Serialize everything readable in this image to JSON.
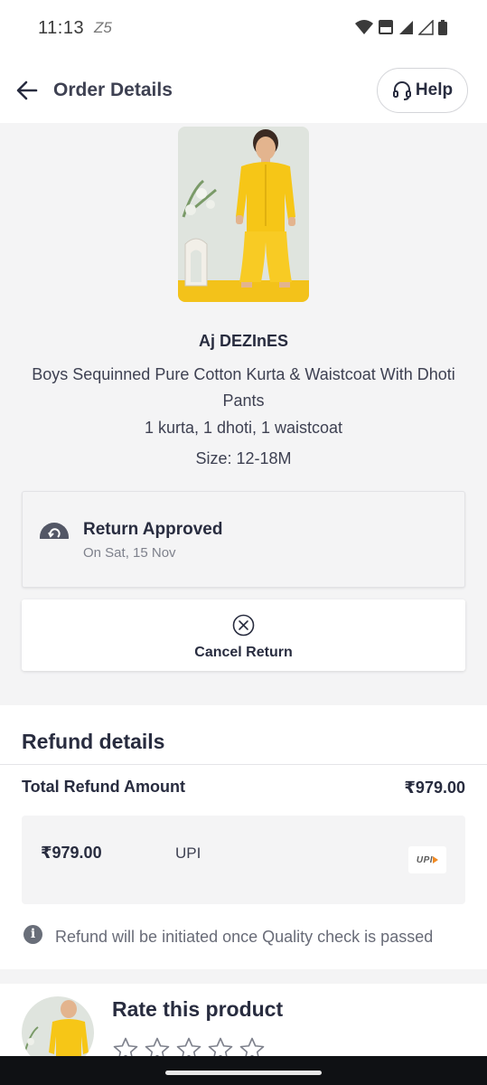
{
  "status_bar": {
    "time": "11:13",
    "indicator": "Z5"
  },
  "header": {
    "title": "Order Details",
    "help_label": "Help"
  },
  "product": {
    "brand": "Aj DEZInES",
    "name": "Boys Sequinned Pure Cotton Kurta & Waistcoat With Dhoti Pants",
    "contents": "1 kurta, 1 dhoti, 1 waistcoat",
    "size": "Size: 12-18M"
  },
  "order_status": {
    "title": "Return Approved",
    "date": "On Sat, 15 Nov"
  },
  "cancel": {
    "label": "Cancel Return"
  },
  "refund": {
    "title": "Refund details",
    "total_label": "Total Refund Amount",
    "total_amount": "₹979.00",
    "method_amount": "₹979.00",
    "method_name": "UPI",
    "method_logo": "UPI",
    "info": "Refund will be initiated once Quality check is passed"
  },
  "rating": {
    "title": "Rate this product",
    "stars_total": 5,
    "stars_selected": 0
  },
  "colors": {
    "accent": "#282c3f",
    "product_yellow": "#f7c51d",
    "page_bg": "#f4f4f5"
  }
}
